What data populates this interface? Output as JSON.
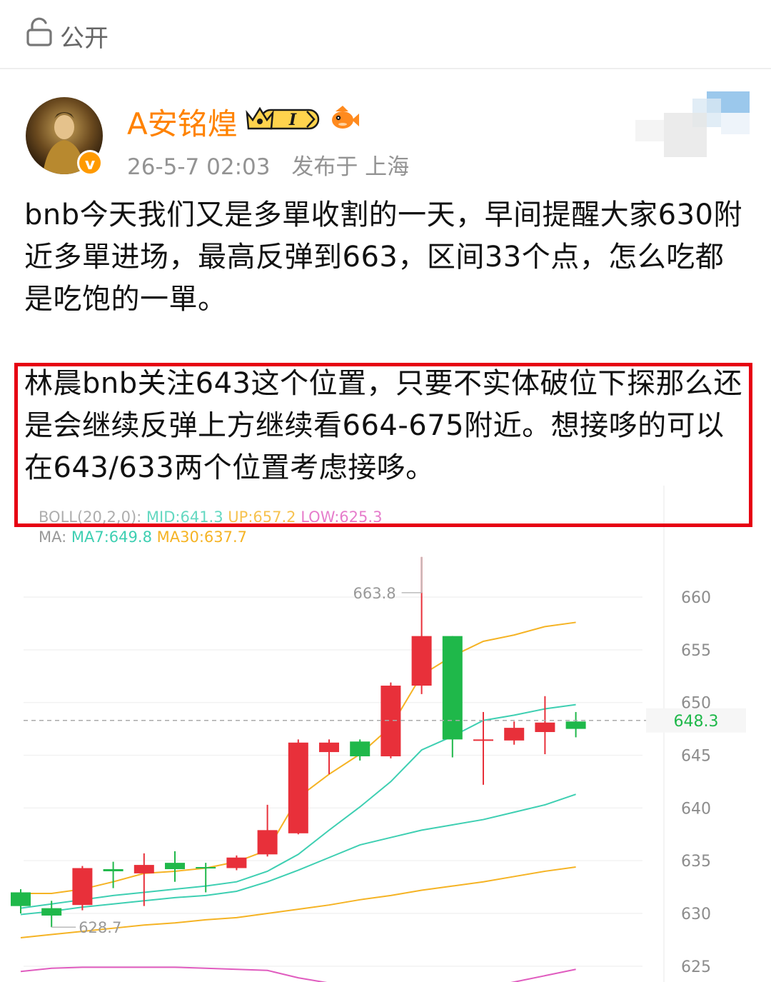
{
  "header": {
    "visibility_label": "公开"
  },
  "post": {
    "username": "A安铭煌",
    "timestamp": "26-5-7 02:03",
    "location": "发布于 上海",
    "paragraph1": "bnb今天我们又是多單收割的一天，早间提醒大家630附近多單进场，最高反弹到663，区间33个点，怎么吃都是吃饱的一單。",
    "paragraph2": "林晨bnb关注643这个位置，只要不实体破位下探那么还是会继续反弹上方继续看664-675附近。想接哆的可以在643/633两个位置考虑接哆。"
  },
  "colors": {
    "up": "#e8303a",
    "down": "#1fb84a",
    "ma7": "#3ecfb2",
    "ma30": "#f5b324",
    "low": "#e05cbf",
    "highlight": "#e60012",
    "username": "#ff8200"
  },
  "chart_data": {
    "type": "candlestick",
    "indicator_boll": {
      "label": "BOLL(20,2,0):",
      "mid": "MID:641.3",
      "up": "UP:657.2",
      "low": "LOW:625.3"
    },
    "indicator_ma": {
      "label": "MA:",
      "ma7": "MA7:649.8",
      "ma30": "MA30:637.7"
    },
    "y_ticks": [
      660,
      655,
      650,
      645,
      640,
      635,
      630,
      625
    ],
    "ylim": [
      623.5,
      666.5
    ],
    "current_price": 648.3,
    "high_label": "663.8",
    "low_label": "628.7",
    "candles": [
      {
        "o": 632.0,
        "c": 630.7,
        "h": 632.3,
        "l": 630.0
      },
      {
        "o": 630.5,
        "c": 629.8,
        "h": 631.2,
        "l": 628.7
      },
      {
        "o": 630.8,
        "c": 634.3,
        "h": 634.5,
        "l": 630.3
      },
      {
        "o": 634.2,
        "c": 634.0,
        "h": 634.9,
        "l": 632.4
      },
      {
        "o": 633.8,
        "c": 634.6,
        "h": 635.7,
        "l": 630.7
      },
      {
        "o": 634.8,
        "c": 634.2,
        "h": 635.9,
        "l": 633.0
      },
      {
        "o": 634.4,
        "c": 634.3,
        "h": 634.8,
        "l": 632.0
      },
      {
        "o": 634.3,
        "c": 635.3,
        "h": 635.5,
        "l": 634.1
      },
      {
        "o": 635.6,
        "c": 637.9,
        "h": 640.3,
        "l": 635.4
      },
      {
        "o": 637.6,
        "c": 646.2,
        "h": 646.5,
        "l": 637.5
      },
      {
        "o": 645.3,
        "c": 646.2,
        "h": 646.5,
        "l": 643.2
      },
      {
        "o": 646.3,
        "c": 644.9,
        "h": 646.5,
        "l": 644.5
      },
      {
        "o": 644.9,
        "c": 651.6,
        "h": 651.9,
        "l": 644.7
      },
      {
        "o": 651.6,
        "c": 656.3,
        "h": 663.8,
        "l": 650.8
      },
      {
        "o": 656.3,
        "c": 646.5,
        "h": 656.3,
        "l": 644.8
      },
      {
        "o": 646.5,
        "c": 646.5,
        "h": 649.1,
        "l": 642.2
      },
      {
        "o": 646.4,
        "c": 647.6,
        "h": 648.2,
        "l": 646.0
      },
      {
        "o": 647.2,
        "c": 648.1,
        "h": 650.6,
        "l": 645.1
      },
      {
        "o": 648.2,
        "c": 647.5,
        "h": 649.1,
        "l": 646.7
      }
    ],
    "ma7": [
      630.5,
      630.9,
      631.3,
      631.7,
      632.0,
      632.3,
      632.6,
      633.0,
      634.0,
      635.6,
      637.9,
      640.1,
      642.5,
      645.5,
      646.8,
      648.3,
      648.8,
      649.4,
      649.8
    ],
    "ma30_inner": [
      631.9,
      631.9,
      632.3,
      633.0,
      633.8,
      634.0,
      634.3,
      634.9,
      636.0,
      641.0,
      643.2,
      645.1,
      647.7,
      652.6,
      654.4,
      655.8,
      656.4,
      657.2,
      657.6
    ],
    "boll_mid": [
      629.9,
      630.2,
      630.6,
      630.9,
      631.2,
      631.5,
      631.7,
      632.1,
      633.0,
      634.1,
      635.3,
      636.5,
      637.2,
      637.9,
      638.4,
      638.9,
      639.6,
      640.3,
      641.3
    ],
    "boll_lower": [
      627.7,
      628.0,
      628.3,
      628.6,
      628.9,
      629.1,
      629.4,
      629.6,
      630.0,
      630.4,
      630.8,
      631.3,
      631.7,
      632.2,
      632.6,
      633.0,
      633.5,
      634.0,
      634.4
    ],
    "boll_low_pink": [
      624.5,
      624.8,
      624.9,
      624.9,
      624.9,
      624.9,
      624.8,
      624.7,
      624.6,
      623.9,
      623.4,
      623.0,
      622.6,
      622.2,
      622.6,
      622.9,
      623.5,
      624.1,
      624.7
    ]
  }
}
